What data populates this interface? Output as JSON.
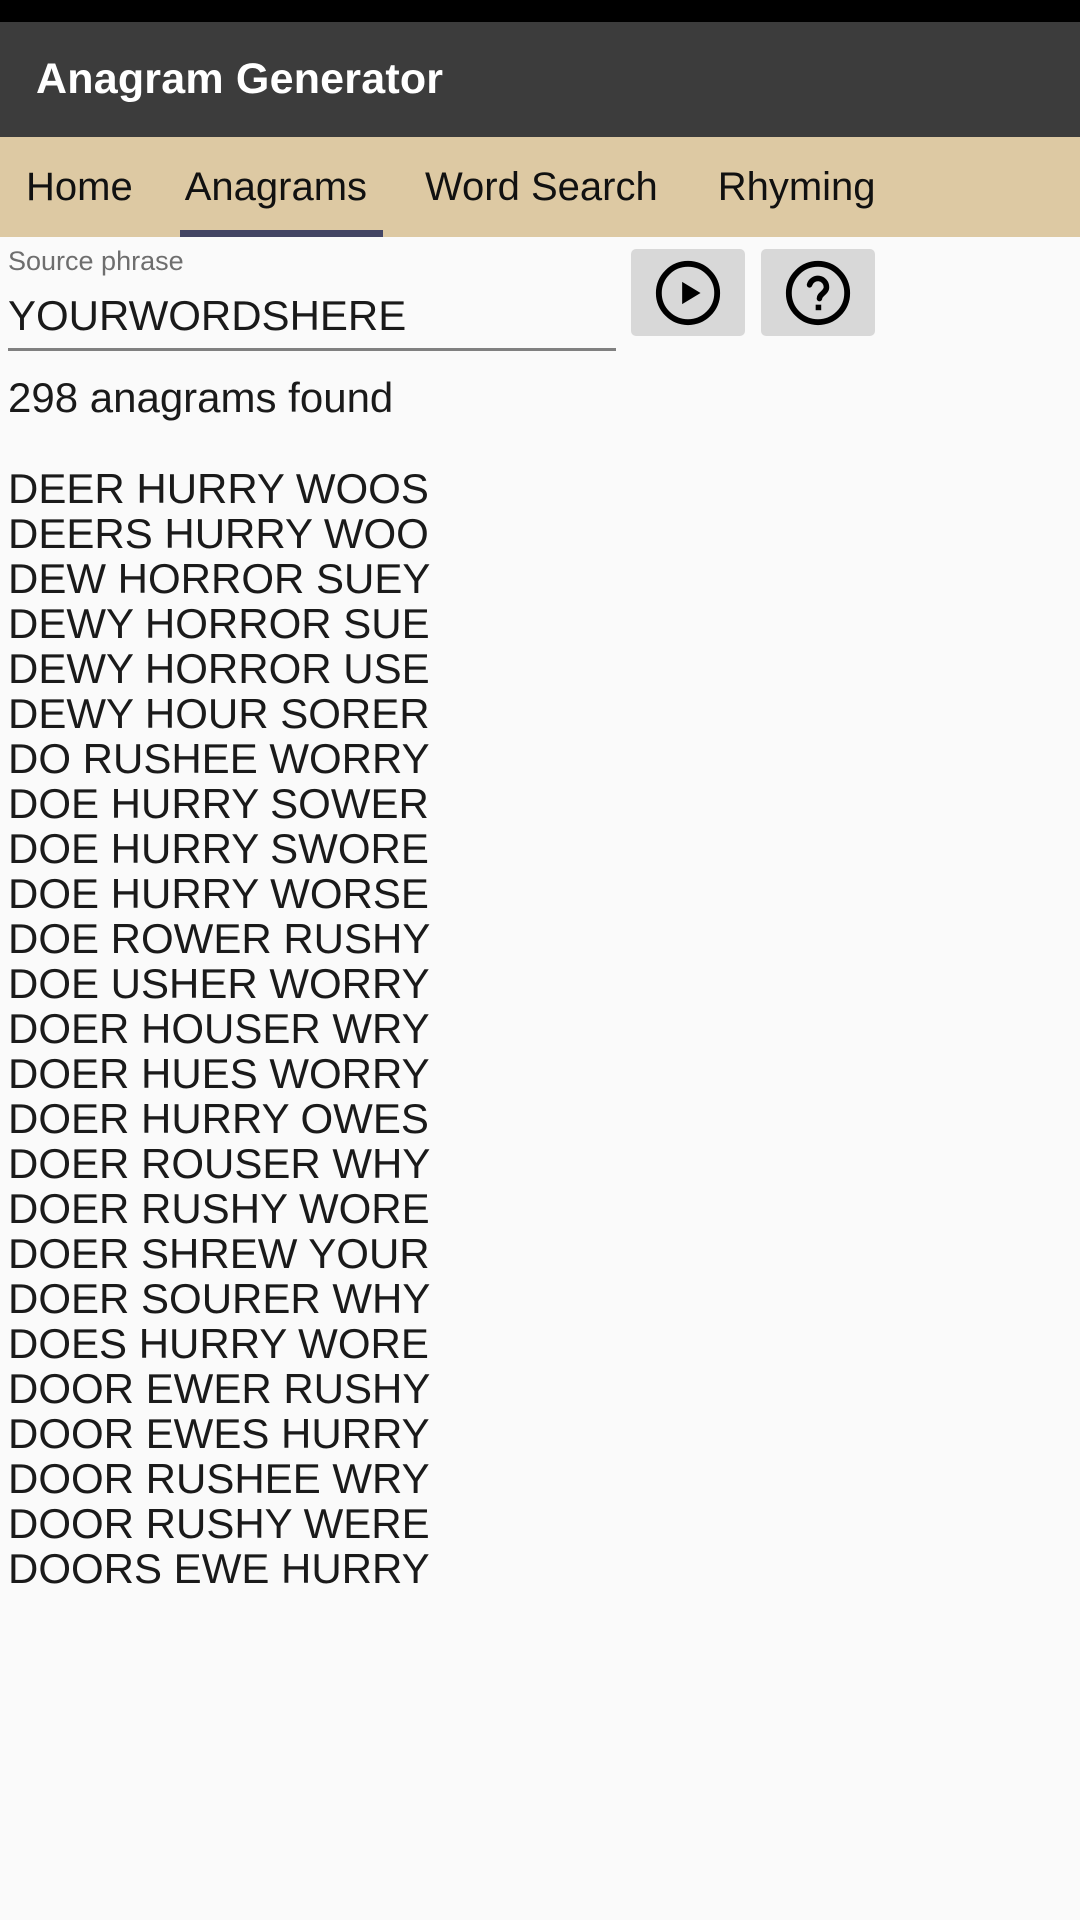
{
  "header": {
    "title": "Anagram Generator",
    "background_color": "#3c3c3c",
    "title_color": "#ffffff"
  },
  "tabs": {
    "background_color": "#ddc9a3",
    "indicator_color": "#434564",
    "active_index": 1,
    "items": [
      {
        "label": "Home"
      },
      {
        "label": "Anagrams"
      },
      {
        "label": "Word Search"
      },
      {
        "label": "Rhyming"
      }
    ]
  },
  "form": {
    "label": "Source phrase",
    "value": "YOURWORDSHERE",
    "placeholder": "Source phrase",
    "run_button": {
      "icon": "play-circle-icon",
      "background_color": "#d8d8d8"
    },
    "help_button": {
      "icon": "help-circle-icon",
      "background_color": "#d8d8d8"
    }
  },
  "results": {
    "count_text": "298 anagrams found",
    "count": 298,
    "items": [
      "DEER HURRY WOOS",
      "DEERS HURRY WOO",
      "DEW HORROR SUEY",
      "DEWY HORROR SUE",
      "DEWY HORROR USE",
      "DEWY HOUR SORER",
      "DO RUSHEE WORRY",
      "DOE HURRY SOWER",
      "DOE HURRY SWORE",
      "DOE HURRY WORSE",
      "DOE ROWER RUSHY",
      "DOE USHER WORRY",
      "DOER HOUSER WRY",
      "DOER HUES WORRY",
      "DOER HURRY OWES",
      "DOER ROUSER WHY",
      "DOER RUSHY WORE",
      "DOER SHREW YOUR",
      "DOER SOURER WHY",
      "DOES HURRY WORE",
      "DOOR EWER RUSHY",
      "DOOR EWES HURRY",
      "DOOR RUSHEE WRY",
      "DOOR RUSHY WERE",
      "DOORS EWE HURRY"
    ]
  }
}
